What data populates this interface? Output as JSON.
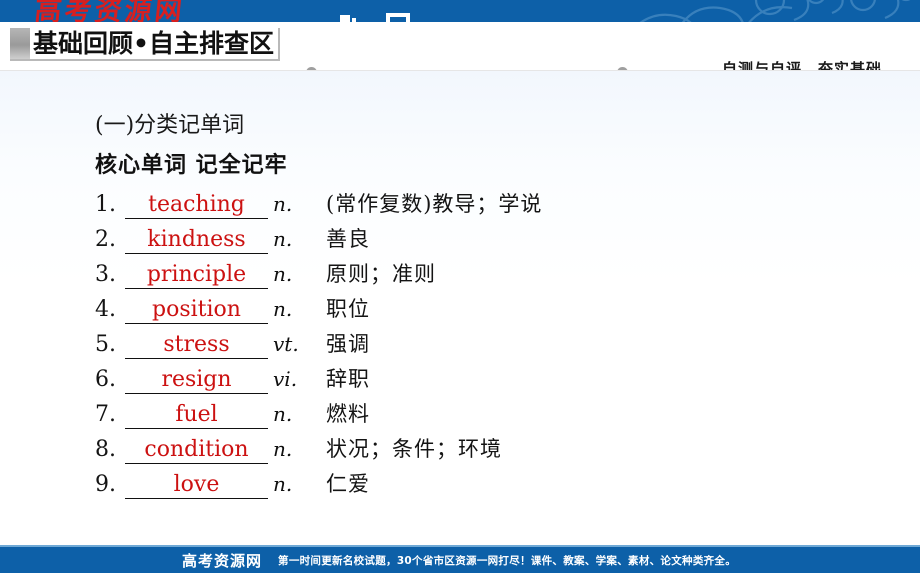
{
  "banner": {
    "watermark_logo": "高考资源网",
    "bg_color": "#0d60a8"
  },
  "header": {
    "section_title": "基础回顾•自主排查区",
    "right_label": "自测与自评　夯实基础"
  },
  "content": {
    "subtitle": "(一)分类记单词",
    "heading": "核心单词  记全记牢",
    "accent_color": "#cc1111",
    "words": [
      {
        "num": "1.",
        "word": "teaching",
        "pos": "n.",
        "meaning": "(常作复数)教导；学说"
      },
      {
        "num": "2.",
        "word": "kindness",
        "pos": "n.",
        "meaning": "善良"
      },
      {
        "num": "3.",
        "word": "principle",
        "pos": "n.",
        "meaning": "原则；准则"
      },
      {
        "num": "4.",
        "word": "position",
        "pos": "n.",
        "meaning": "职位"
      },
      {
        "num": "5.",
        "word": "stress",
        "pos": "vt.",
        "meaning": "强调"
      },
      {
        "num": "6.",
        "word": "resign",
        "pos": "vi.",
        "meaning": "辞职"
      },
      {
        "num": "7.",
        "word": "fuel",
        "pos": "n.",
        "meaning": "燃料"
      },
      {
        "num": "8.",
        "word": "condition",
        "pos": "n.",
        "meaning": "状况；条件；环境"
      },
      {
        "num": "9.",
        "word": "love",
        "pos": "n.",
        "meaning": "仁爱"
      }
    ]
  },
  "footer": {
    "brand": "高考资源网",
    "slogan": "第一时间更新名校试题，30个省市区资源一网打尽！课件、教案、学案、素材、论文种类齐全。",
    "bg_color": "#0d60a8"
  }
}
